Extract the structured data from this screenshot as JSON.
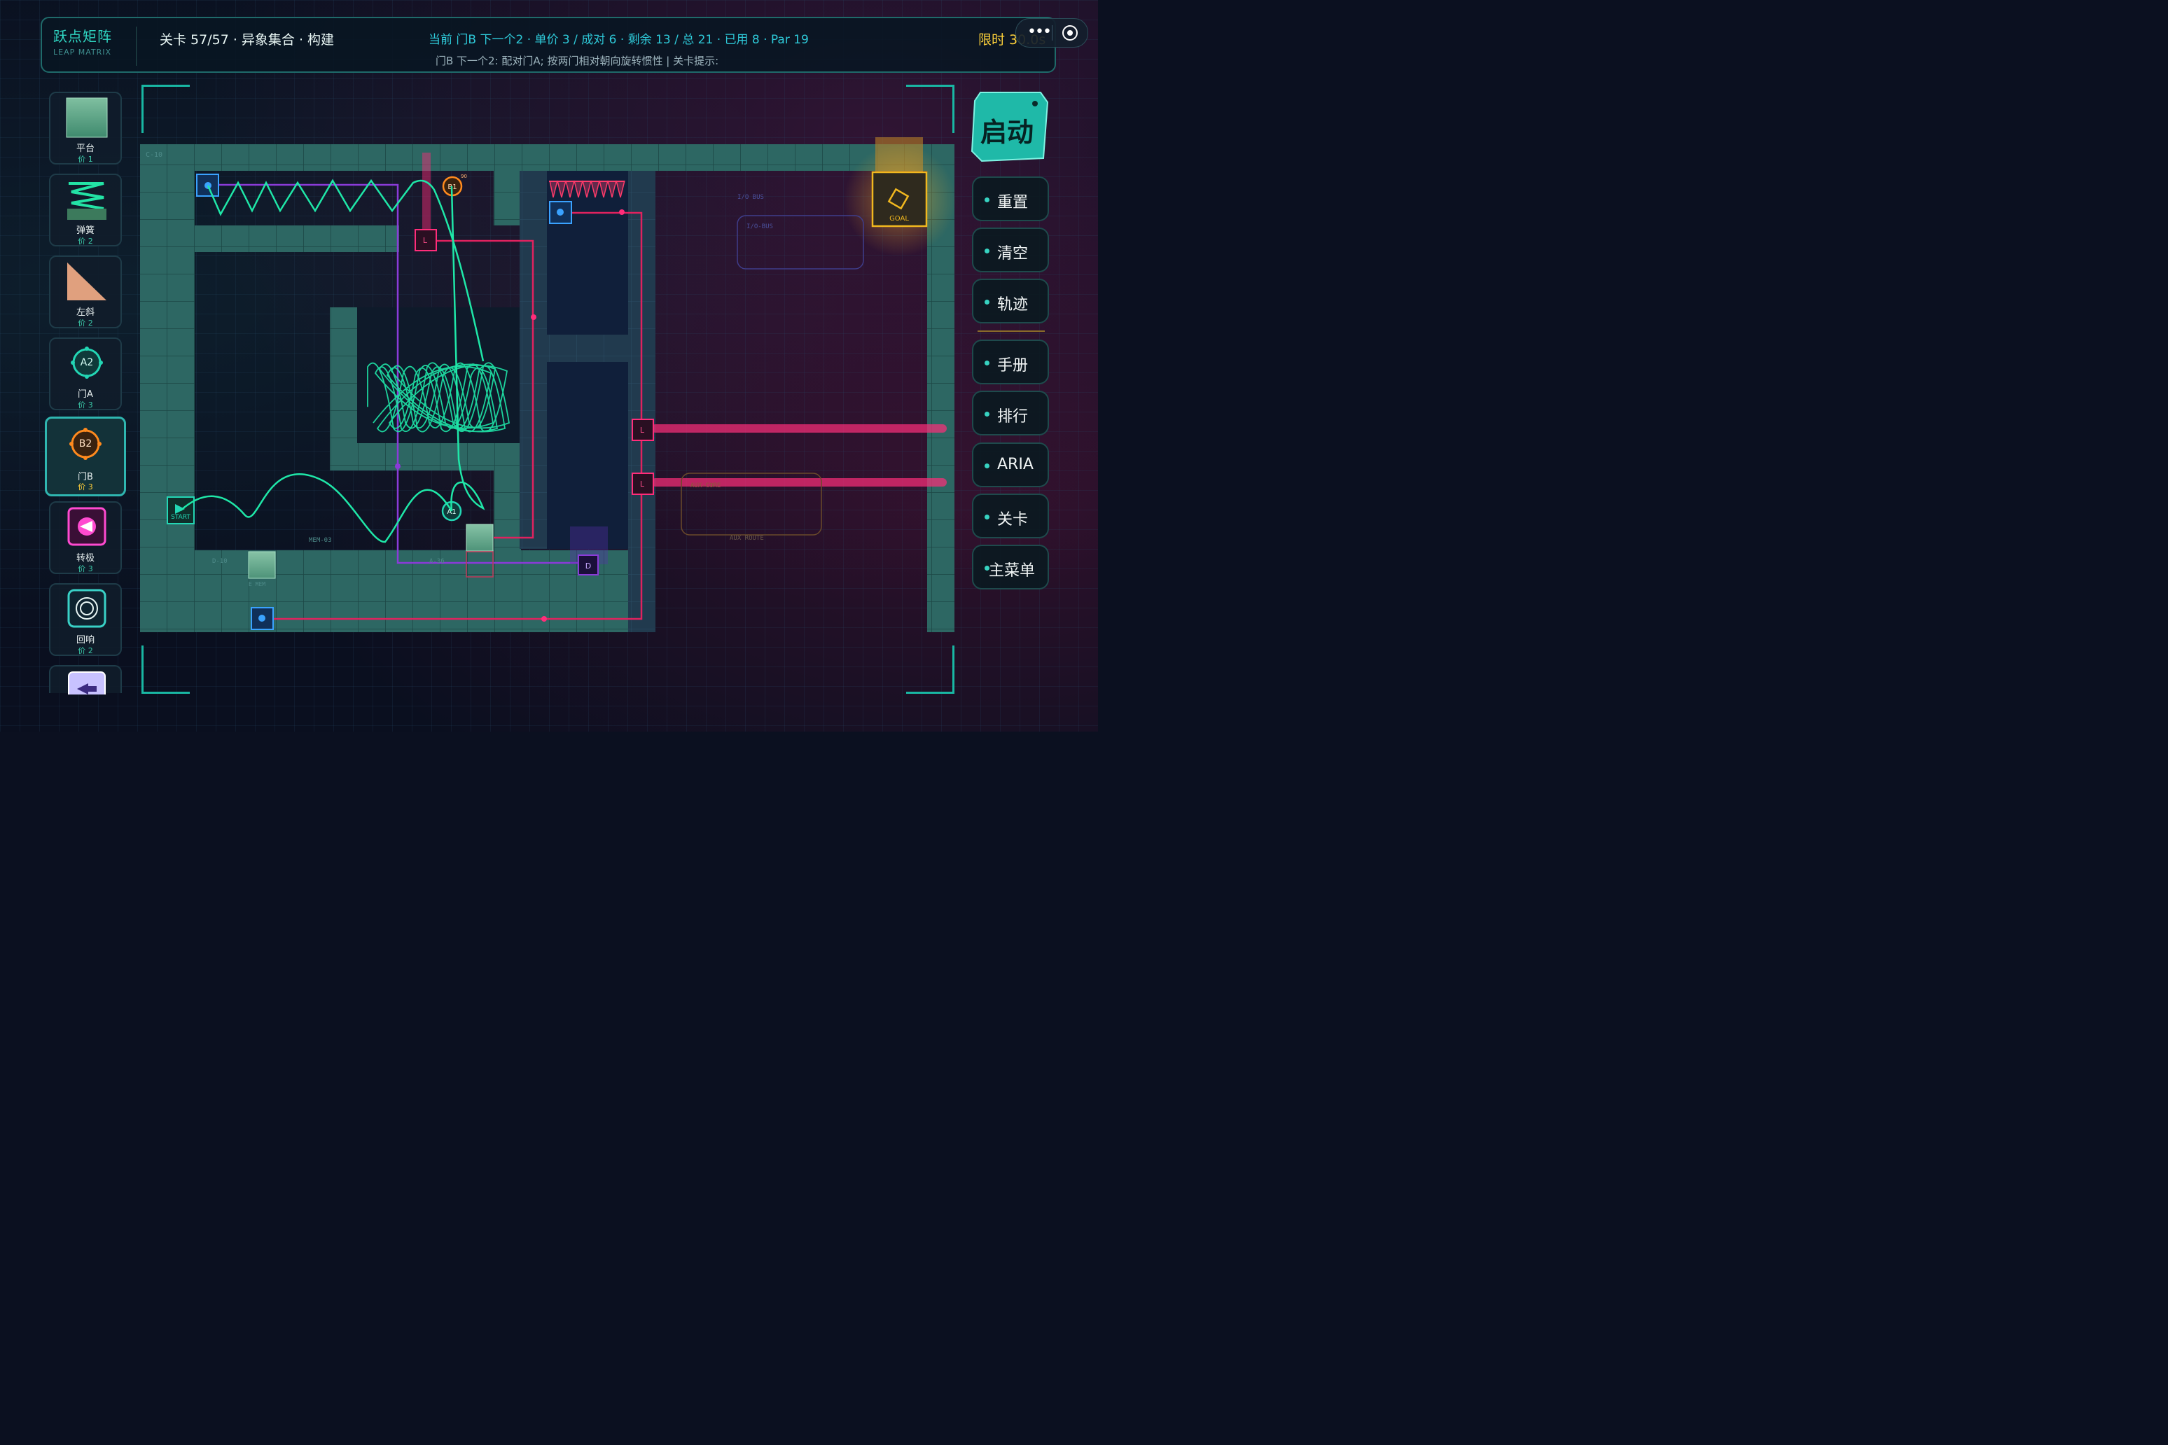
{
  "hud": {
    "brand": "跃点矩阵",
    "brand_en": "LEAP MATRIX",
    "level": "关卡 57/57  ·  异象集合  ·  构建",
    "stats": "当前 门B 下一个2 · 单价 3 / 成对 6 · 剩余 13 / 总 21 · 已用 8 · Par 19",
    "hint": "门B 下一个2: 配对门A; 按两门相对朝向旋转惯性  |  关卡提示:",
    "timer": "限时 30.0s"
  },
  "window_controls": {
    "more_icon": "more-dots-icon",
    "close_icon": "record-circle-icon"
  },
  "palette": [
    {
      "name": "平台",
      "cost": "价 1",
      "icon": "platform-icon"
    },
    {
      "name": "弹簧",
      "cost": "价 2",
      "icon": "spring-icon"
    },
    {
      "name": "左斜",
      "cost": "价 2",
      "icon": "left-ramp-icon"
    },
    {
      "name": "门A",
      "cost": "价 3",
      "badge": "A2",
      "icon": "portal-a-icon"
    },
    {
      "name": "门B",
      "cost": "价 3",
      "badge": "B2",
      "icon": "portal-b-icon",
      "selected": true
    },
    {
      "name": "转极",
      "cost": "价 3",
      "icon": "polarity-switch-icon"
    },
    {
      "name": "回响",
      "cost": "价 2",
      "icon": "echo-icon"
    }
  ],
  "menu": {
    "start": "启动",
    "items": [
      "重置",
      "清空",
      "轨迹",
      "手册",
      "排行",
      "ARIA",
      "关卡",
      "主菜单"
    ]
  },
  "board": {
    "labels": {
      "start": "START",
      "goal": "GOAL",
      "b1": "B1",
      "a1": "A1",
      "d": "D",
      "laser": "L",
      "zone_c10": "C-10",
      "zone_d10": "D-10",
      "zone_a36": "A-36",
      "mem": "MEM-03",
      "io_bus": "I/O-BUS",
      "io_bus2": "I/O BUS",
      "aux_core": "AUX-CORE",
      "aux_route": "AUX ROUTE",
      "e_mem": "E MEM",
      "b1_small": "90"
    },
    "colors": {
      "wall": "#2e6a66",
      "trail": "#1fe7a8",
      "laser": "#ff2d7a",
      "goal": "#f1b81f",
      "portal_b": "#ff8a1e",
      "wire_purple": "#8a3bd8"
    }
  }
}
